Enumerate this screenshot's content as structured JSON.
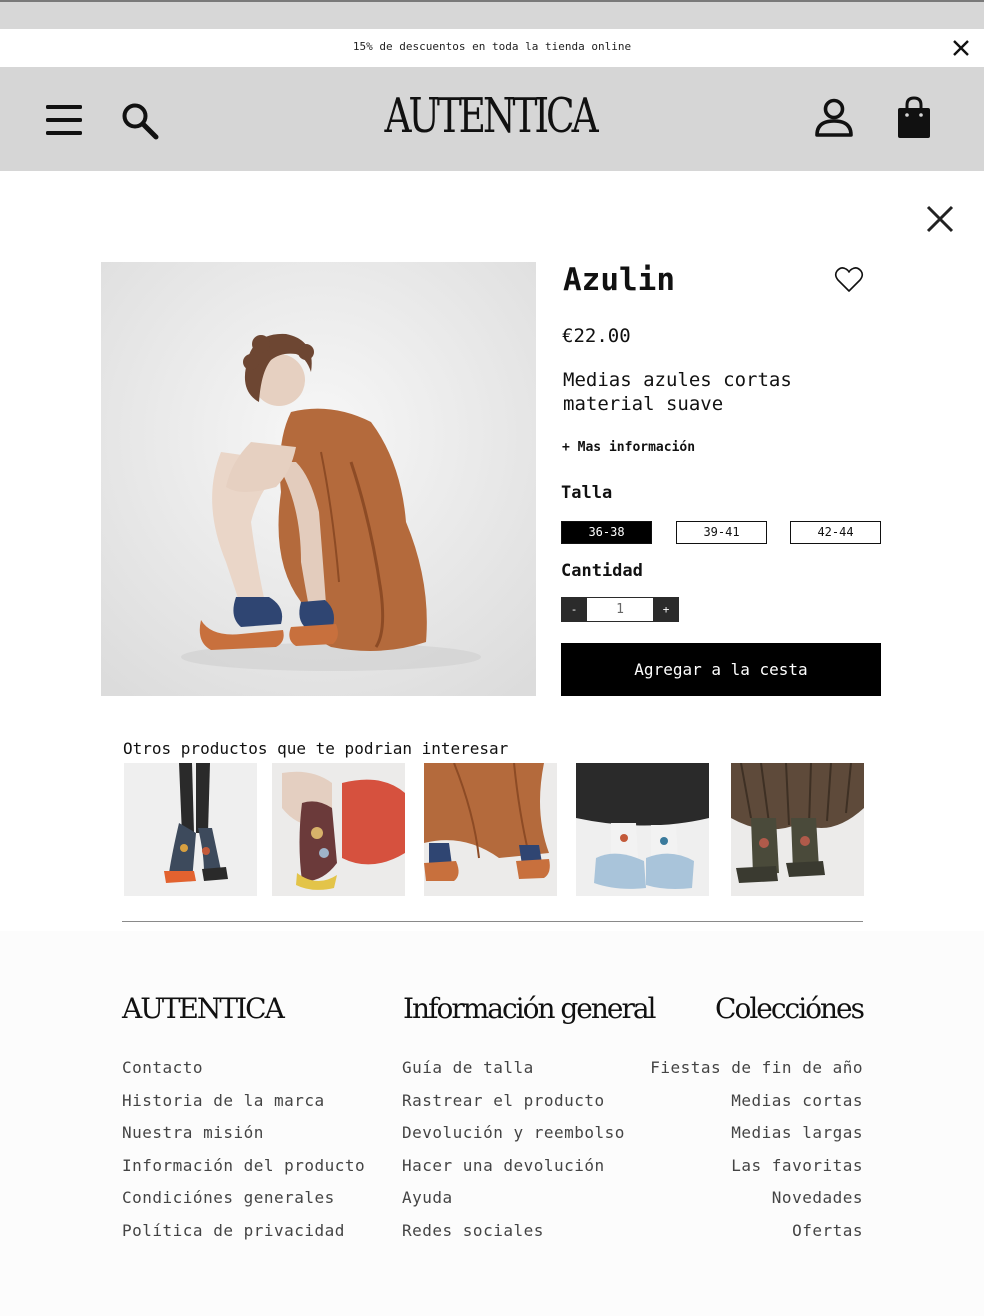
{
  "promo": {
    "text": "15% de descuentos en toda la tienda online"
  },
  "header": {
    "logo": "AUTENTICA"
  },
  "product": {
    "name": "Azulin",
    "price": "€22.00",
    "description": "Medias azules cortas material suave",
    "more_info": "+ Mas información",
    "size_label": "Talla",
    "sizes": [
      "36-38",
      "39-41",
      "42-44"
    ],
    "selected_size": "36-38",
    "quantity_label": "Cantidad",
    "qty_minus": "-",
    "qty_plus": "+",
    "quantity": "1",
    "add_to_cart": "Agregar a la cesta"
  },
  "related": {
    "title": "Otros productos que te podrian interesar"
  },
  "footer": {
    "brand": {
      "title": "AUTENTICA",
      "links": [
        "Contacto",
        "Historia de la marca",
        "Nuestra misión",
        "Información del producto",
        "Condiciónes generales",
        "Política de privacidad"
      ]
    },
    "info": {
      "title": "Información general",
      "links": [
        "Guía de talla",
        "Rastrear el producto",
        "Devolución y reembolso",
        "Hacer una devolución",
        "Ayuda",
        "Redes sociales"
      ]
    },
    "collections": {
      "title": "Colecciónes",
      "links": [
        "Fiestas de fin de año",
        "Medias cortas",
        "Medias largas",
        "Las favoritas",
        "Novedades",
        "Ofertas"
      ]
    }
  },
  "colors": {
    "header_bg": "#d6d6d6",
    "accent": "#000000"
  }
}
